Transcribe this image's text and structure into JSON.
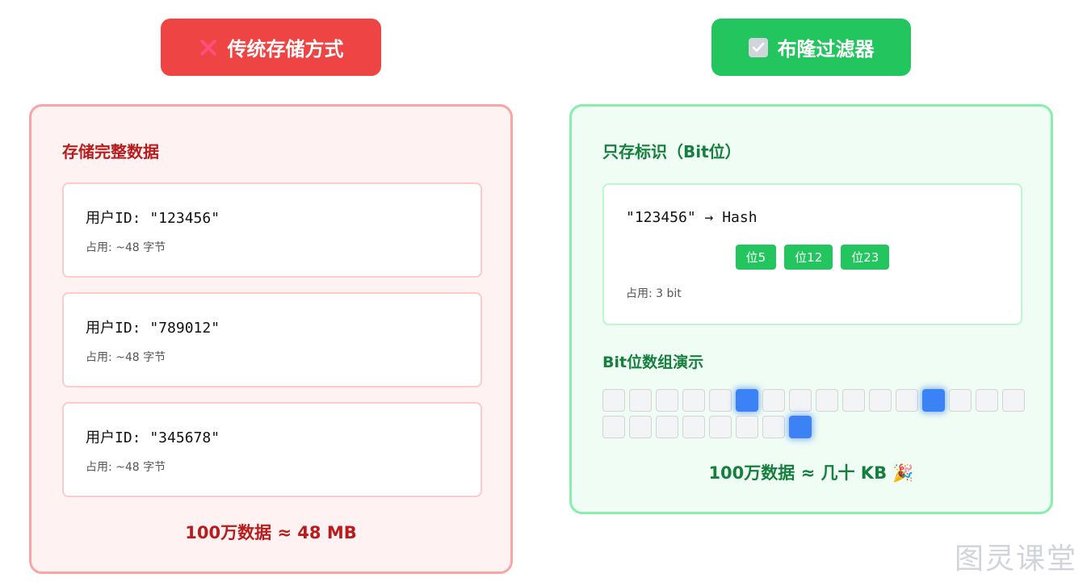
{
  "header_left": {
    "icon": "cross-mark-icon",
    "label": "传统存储方式"
  },
  "header_right": {
    "icon": "check-box-icon",
    "label": "布隆过滤器"
  },
  "traditional": {
    "title": "存储完整数据",
    "records": [
      {
        "id": "用户ID: \"123456\"",
        "size": "占用: ~48 字节"
      },
      {
        "id": "用户ID: \"789012\"",
        "size": "占用: ~48 字节"
      },
      {
        "id": "用户ID: \"345678\"",
        "size": "占用: ~48 字节"
      }
    ],
    "summary": "100万数据 ≈ 48 MB"
  },
  "bloom": {
    "title": "只存标识（Bit位）",
    "hash_line": "\"123456\" → Hash",
    "chips": [
      "位5",
      "位12",
      "位23"
    ],
    "size": "占用: 3 bit",
    "bit_title": "Bit位数组演示",
    "bits": [
      0,
      0,
      0,
      0,
      0,
      1,
      0,
      0,
      0,
      0,
      0,
      0,
      1,
      0,
      0,
      0,
      0,
      0,
      0,
      0,
      0,
      0,
      0,
      1
    ],
    "summary": "100万数据 ≈ 几十 KB 🎉"
  },
  "watermark": "图灵课堂",
  "colors": {
    "red": "#ef4444",
    "green": "#22c55e",
    "bit_on": "#3b82f6"
  }
}
